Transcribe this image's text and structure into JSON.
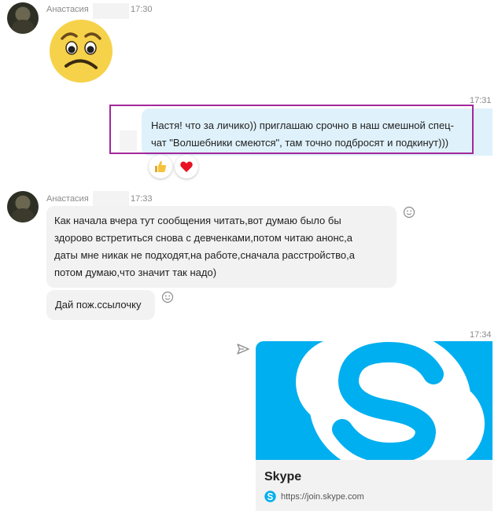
{
  "messages": {
    "m1": {
      "sender": "Анастасия",
      "time": "17:30"
    },
    "m2": {
      "time": "17:31",
      "line1": "Настя! что за личико)) приглашаю срочно в наш смешной спец-",
      "line2": "чат \"Волшебники смеются\", там точно подбросят и подкинут)))"
    },
    "m3": {
      "sender": "Анастасия",
      "time": "17:33",
      "lines": [
        "Как начала вчера тут сообщения читать,вот думаю было бы",
        "здорово встретиться снова с девченками,потом читаю анонс,а",
        "даты мне никак не подходят,на работе,сначала расстройство,а",
        "потом думаю,что значит так надо)"
      ]
    },
    "m4": {
      "text": "Дай пож.ссылочку"
    },
    "m5": {
      "time": "17:34",
      "card_title": "Skype",
      "card_url": "https://join.skype.com"
    }
  },
  "colors": {
    "incoming_bubble": "#f2f2f2",
    "outgoing_bubble": "#dff1fb",
    "highlight_border": "#a3289b",
    "skype_blue": "#00aff0",
    "heart_red": "#e81123"
  },
  "icons": {
    "emoji": "worried-face-icon",
    "reaction1": "thumbs-up-icon",
    "reaction2": "heart-icon",
    "add_reaction": "smile-icon",
    "forward": "share-arrow-icon",
    "brand": "skype-logo-icon"
  }
}
